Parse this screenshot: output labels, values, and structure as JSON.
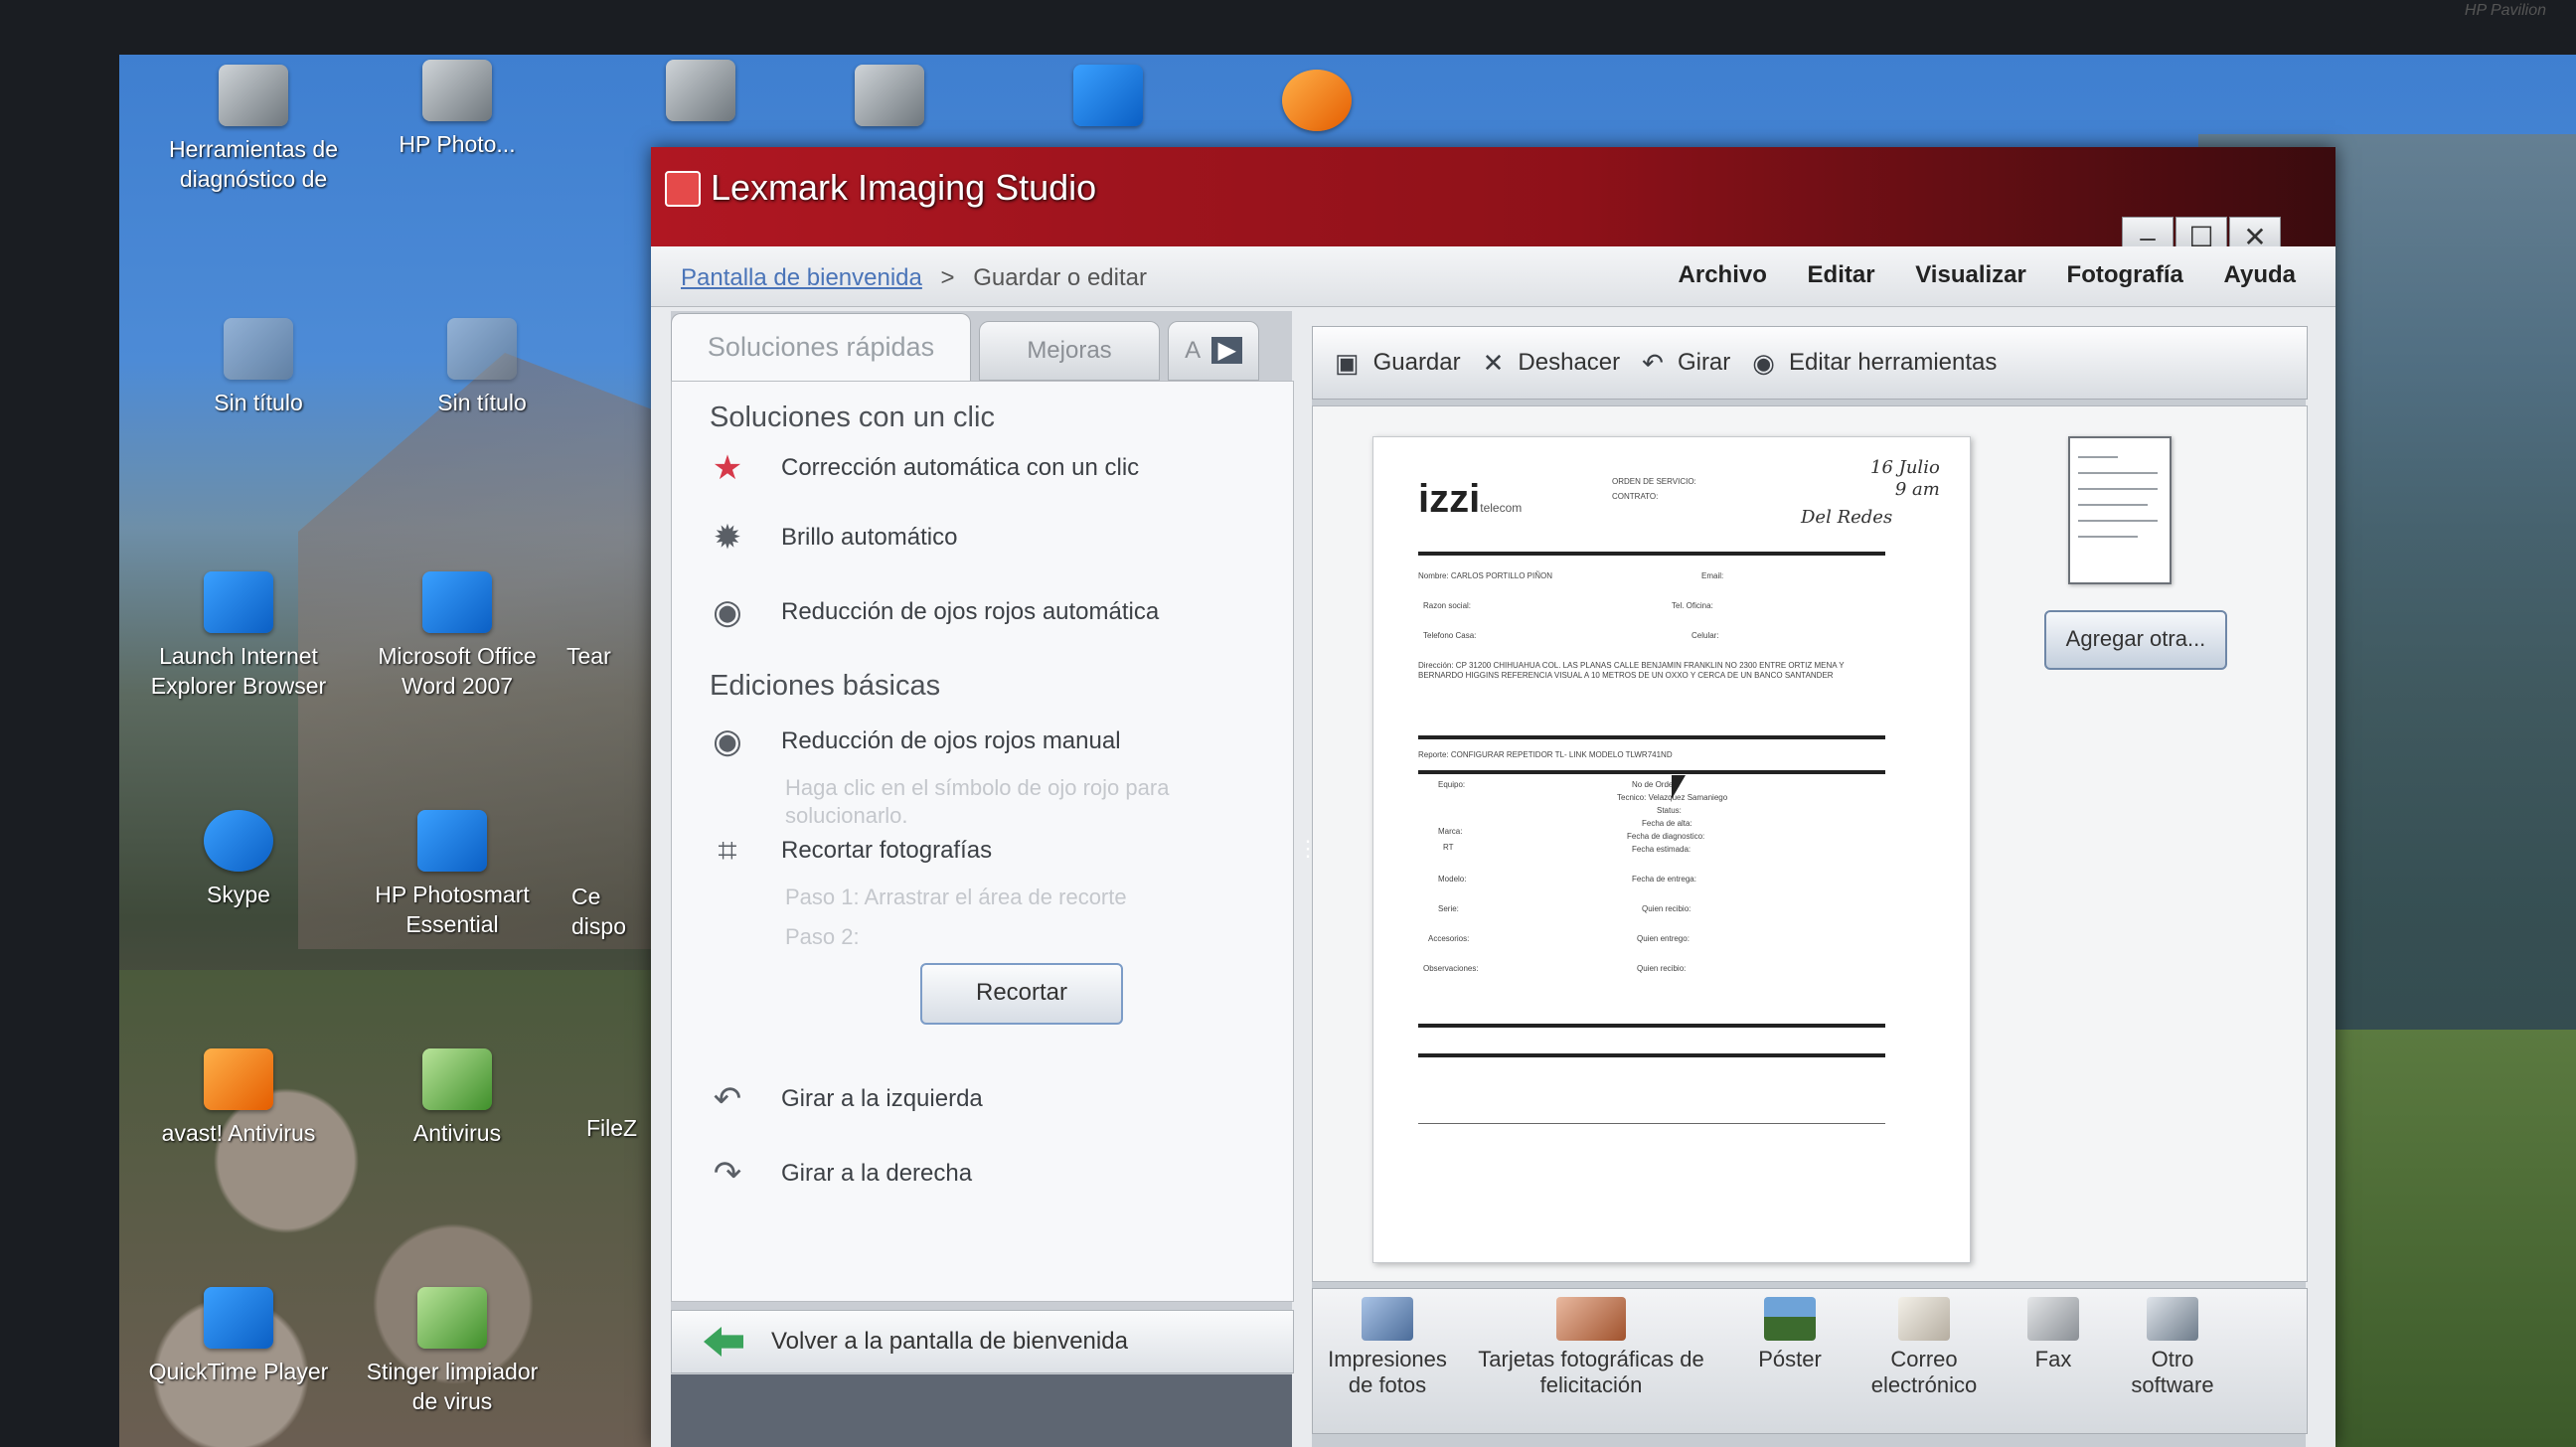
{
  "desktop": {
    "icons": [
      {
        "label": "Herramientas de diagnóstico de",
        "name": "desktop-icon-herramientas"
      },
      {
        "label": "HP Photo...",
        "name": "desktop-icon-hp-photo"
      },
      {
        "label": "",
        "name": "desktop-icon-3"
      },
      {
        "label": "",
        "name": "desktop-icon-4"
      },
      {
        "label": "",
        "name": "desktop-icon-5"
      },
      {
        "label": "",
        "name": "desktop-icon-chrome"
      },
      {
        "label": "Sin título",
        "name": "desktop-icon-sin-titulo"
      },
      {
        "label": "Sin título",
        "name": "desktop-icon-sin-titulo-2"
      },
      {
        "label": "Launch Internet Explorer Browser",
        "name": "desktop-icon-ie"
      },
      {
        "label": "Microsoft Office Word 2007",
        "name": "desktop-icon-word"
      },
      {
        "label": "Tear",
        "name": "desktop-icon-tear"
      },
      {
        "label": "Skype",
        "name": "desktop-icon-skype"
      },
      {
        "label": "HP Photosmart Essential",
        "name": "desktop-icon-hp-photosmart"
      },
      {
        "label": "Ce dispo",
        "name": "desktop-icon-ce"
      },
      {
        "label": "avast! Antivirus",
        "name": "desktop-icon-avast"
      },
      {
        "label": "Antivirus",
        "name": "desktop-icon-antivirus"
      },
      {
        "label": "FileZ",
        "name": "desktop-icon-filez"
      },
      {
        "label": "QuickTime Player",
        "name": "desktop-icon-quicktime"
      },
      {
        "label": "Stinger limpiador de virus",
        "name": "desktop-icon-stinger"
      }
    ],
    "brand": "HP Pavilion"
  },
  "window": {
    "title": "Lexmark Imaging Studio",
    "controls": {
      "minimize": "–",
      "maximize": "☐",
      "close": "✕"
    }
  },
  "breadcrumb": {
    "home": "Pantalla de bienvenida",
    "separator": ">",
    "current": "Guardar o editar"
  },
  "menu": [
    "Archivo",
    "Editar",
    "Visualizar",
    "Fotografía",
    "Ayuda"
  ],
  "tabs": {
    "quick": "Soluciones rápidas",
    "enhance": "Mejoras",
    "third": "A"
  },
  "quickfix": {
    "section1": "Soluciones con un clic",
    "items1": [
      {
        "label": "Corrección automática con un clic",
        "icon": "star-icon"
      },
      {
        "label": "Brillo automático",
        "icon": "sun-icon"
      },
      {
        "label": "Reducción de ojos rojos automática",
        "icon": "eye-icon"
      }
    ],
    "section2": "Ediciones básicas",
    "redeye_manual": "Reducción de ojos rojos manual",
    "redeye_hint": "Haga clic en el símbolo de ojo rojo para solucionarlo.",
    "crop": "Recortar fotografías",
    "crop_step1": "Paso 1: Arrastrar el área de recorte",
    "crop_step2": "Paso 2:",
    "crop_button": "Recortar",
    "rotate_left": "Girar a la izquierda",
    "rotate_right": "Girar a la derecha"
  },
  "back": "Volver a la pantalla de bienvenida",
  "toolbar": {
    "save": "Guardar",
    "undo": "Deshacer",
    "rotate": "Girar",
    "edit_tools": "Editar herramientas"
  },
  "document": {
    "logo": "izzi",
    "logo_sub": "telecom",
    "handwriting1": "16 Julio",
    "handwriting2": "9 am",
    "handwriting3": "Del Redes",
    "order": "ORDEN DE SERVICIO:",
    "contract": "CONTRATO:",
    "name": "Nombre: CARLOS PORTILLO PIÑON",
    "email": "Email:",
    "razon": "Razon social:",
    "tel_office": "Tel. Oficina:",
    "tel_home": "Telefono Casa:",
    "cel": "Celular:",
    "address": "Dirección: CP 31200 CHIHUAHUA COL. LAS PLANAS CALLE BENJAMIN FRANKLIN NO 2300 ENTRE ORTIZ MENA Y BERNARDO HIGGINS REFERENCIA VISUAL A 10 METROS DE UN OXXO Y CERCA DE UN BANCO SANTANDER",
    "report": "Reporte: CONFIGURAR REPETIDOR TL- LINK MODELO TLWR741ND",
    "equipo": "Equipo:",
    "no_orden": "No de Orden:",
    "tecnico": "Tecnico: Velazquez Samaniego",
    "status": "Status:",
    "fecha_alta": "Fecha de alta:",
    "marca": "Marca:",
    "fecha_diag": "Fecha de diagnostico:",
    "rt": "RT",
    "fecha_est": "Fecha estimada:",
    "modelo": "Modelo:",
    "fecha_entrega": "Fecha de entrega:",
    "serie": "Serie:",
    "quien_recibio": "Quien recibio:",
    "accesorios": "Accesorios:",
    "quien_entrego": "Quien entrego:",
    "observaciones": "Observaciones:",
    "quien_recibio2": "Quien recibio:"
  },
  "add_button": "Agregar otra...",
  "outputs": [
    {
      "label": "Impresiones de fotos",
      "name": "output-photo-prints",
      "icon": "photo"
    },
    {
      "label": "Tarjetas fotográficas de felicitación",
      "name": "output-greeting-cards",
      "icon": "card"
    },
    {
      "label": "Póster",
      "name": "output-poster",
      "icon": "poster"
    },
    {
      "label": "Correo electrónico",
      "name": "output-email",
      "icon": "mail"
    },
    {
      "label": "Fax",
      "name": "output-fax",
      "icon": "fax"
    },
    {
      "label": "Otro software",
      "name": "output-other-software",
      "icon": "soft"
    }
  ]
}
